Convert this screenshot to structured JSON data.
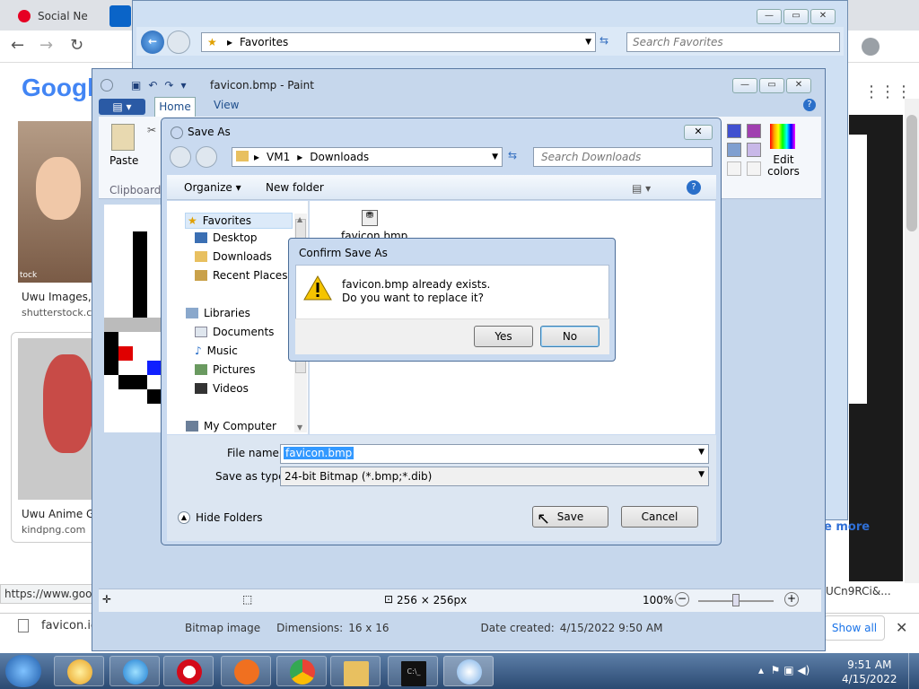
{
  "chrome": {
    "tab1_label": "Social Ne",
    "tab_icon": "pinterest-icon",
    "google_logo": "Googl",
    "results": [
      {
        "title": "Uwu Images, S",
        "source": "shutterstock.co"
      },
      {
        "title": "Uwu Anime Gi",
        "source": "kindpng.com"
      }
    ],
    "watermark": "tock",
    "status_url": "https://www.goog",
    "more_link": "e more",
    "url_code": "UCn9RCi&...",
    "download_file": "favicon.ico",
    "show_all": "Show all"
  },
  "favorites_window": {
    "address": "Favorites",
    "search_placeholder": "Search Favorites"
  },
  "paint": {
    "title": "favicon.bmp - Paint",
    "tabs": [
      "Home",
      "View"
    ],
    "paste_label": "Paste",
    "clipboard_group": "Clipboard",
    "edit_colors": "Edit colors",
    "status_dims": "256 × 256px",
    "zoom": "100%",
    "file_type": "Bitmap image",
    "dimensions_label": "Dimensions:",
    "dimensions": "16 x 16",
    "date_label": "Date created:",
    "date_created": "4/15/2022 9:50 AM",
    "palette": [
      "#4050d0",
      "#a040b0",
      "#7f9fd0",
      "#c8b8e8"
    ]
  },
  "save_as": {
    "title": "Save As",
    "path": [
      "VM1",
      "Downloads"
    ],
    "search_placeholder": "Search Downloads",
    "organize": "Organize",
    "new_folder": "New folder",
    "nav": {
      "favorites": "Favorites",
      "desktop": "Desktop",
      "downloads": "Downloads",
      "recent": "Recent Places",
      "libraries": "Libraries",
      "documents": "Documents",
      "music": "Music",
      "pictures": "Pictures",
      "videos": "Videos",
      "computer": "My Computer"
    },
    "file_item": "favicon.bmp",
    "file_name_label": "File name:",
    "file_name_value": "favicon.bmp",
    "type_label": "Save as type:",
    "type_value": "24-bit Bitmap (*.bmp;*.dib)",
    "hide_folders": "Hide Folders",
    "save": "Save",
    "cancel": "Cancel"
  },
  "confirm": {
    "title": "Confirm Save As",
    "line1": "favicon.bmp already exists.",
    "line2": "Do you want to replace it?",
    "yes": "Yes",
    "no": "No"
  },
  "taskbar": {
    "time": "9:51 AM",
    "date": "4/15/2022"
  }
}
